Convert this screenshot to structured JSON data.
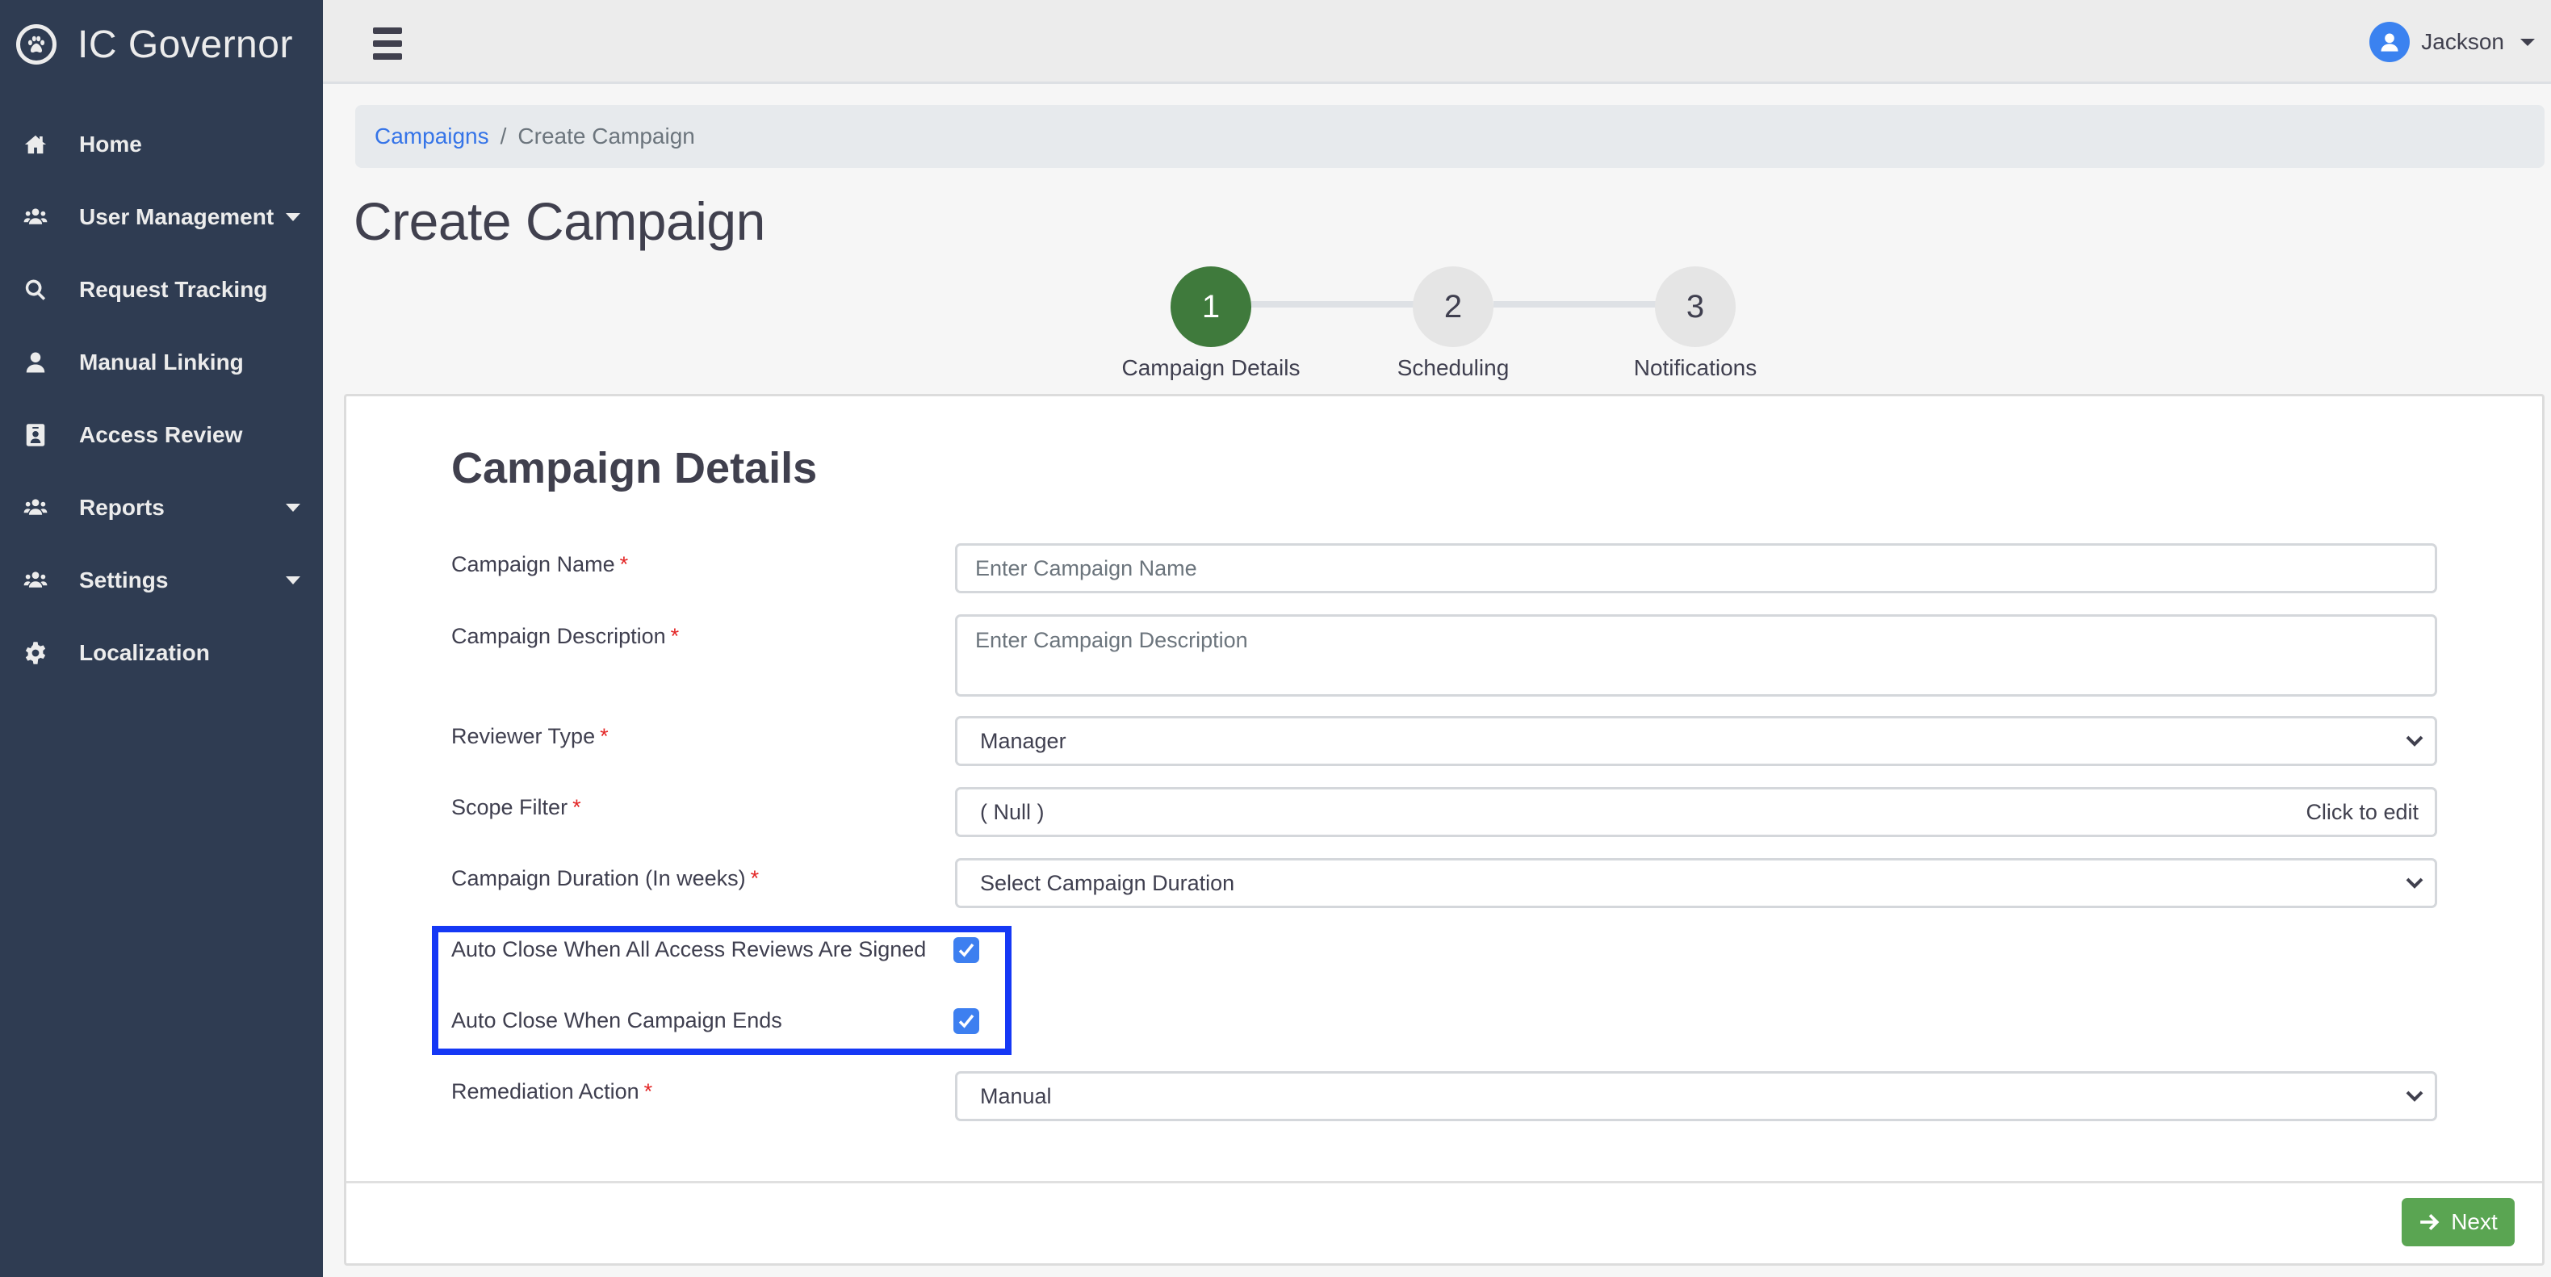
{
  "app": {
    "title": "IC Governor",
    "logo_icon": "paw-circle-icon"
  },
  "sidebar": {
    "items": [
      {
        "label": "Home",
        "icon": "home-icon",
        "has_submenu": false
      },
      {
        "label": "User Management",
        "icon": "users-icon",
        "has_submenu": true
      },
      {
        "label": "Request Tracking",
        "icon": "search-icon",
        "has_submenu": false
      },
      {
        "label": "Manual Linking",
        "icon": "user-icon",
        "has_submenu": false
      },
      {
        "label": "Access Review",
        "icon": "id-badge-icon",
        "has_submenu": false
      },
      {
        "label": "Reports",
        "icon": "users-icon",
        "has_submenu": true
      },
      {
        "label": "Settings",
        "icon": "users-icon",
        "has_submenu": true
      },
      {
        "label": "Localization",
        "icon": "gear-icon",
        "has_submenu": false
      }
    ]
  },
  "topbar": {
    "menu_icon": "hamburger-icon",
    "user": {
      "name": "Jackson",
      "icon": "user-circle-icon"
    }
  },
  "breadcrumb": {
    "items": [
      {
        "label": "Campaigns",
        "link": true
      },
      {
        "label": "Create Campaign",
        "link": false
      }
    ],
    "separator": "/"
  },
  "page": {
    "title": "Create Campaign"
  },
  "stepper": {
    "current_step": 1,
    "steps": [
      {
        "number": "1",
        "label": "Campaign Details",
        "active": true
      },
      {
        "number": "2",
        "label": "Scheduling",
        "active": false
      },
      {
        "number": "3",
        "label": "Notifications",
        "active": false
      }
    ]
  },
  "form": {
    "section_title": "Campaign Details",
    "required_marker": "*",
    "fields": {
      "campaign_name": {
        "label": "Campaign Name",
        "required": true,
        "value": "",
        "placeholder": "Enter Campaign Name"
      },
      "campaign_description": {
        "label": "Campaign Description",
        "required": true,
        "value": "",
        "placeholder": "Enter Campaign Description"
      },
      "reviewer_type": {
        "label": "Reviewer Type",
        "required": true,
        "selected": "Manager"
      },
      "scope_filter": {
        "label": "Scope Filter",
        "required": true,
        "value": "( Null )",
        "action_text": "Click to edit"
      },
      "campaign_duration": {
        "label": "Campaign Duration (In weeks)",
        "required": true,
        "selected": "Select Campaign Duration"
      },
      "auto_close_all_signed": {
        "label": "Auto Close When All Access Reviews Are Signed",
        "checked": true
      },
      "auto_close_campaign_ends": {
        "label": "Auto Close When Campaign Ends",
        "checked": true
      },
      "remediation_action": {
        "label": "Remediation Action",
        "required": true,
        "selected": "Manual"
      }
    }
  },
  "footer": {
    "next_label": "Next",
    "next_icon": "arrow-right-icon"
  },
  "colors": {
    "sidebar_bg": "#2f3c52",
    "active_step": "#3f7a3c",
    "next_button": "#5aa552",
    "checkbox": "#3d7ff0",
    "link": "#3574e8",
    "required": "#e32626",
    "highlight": "#1538f5"
  }
}
